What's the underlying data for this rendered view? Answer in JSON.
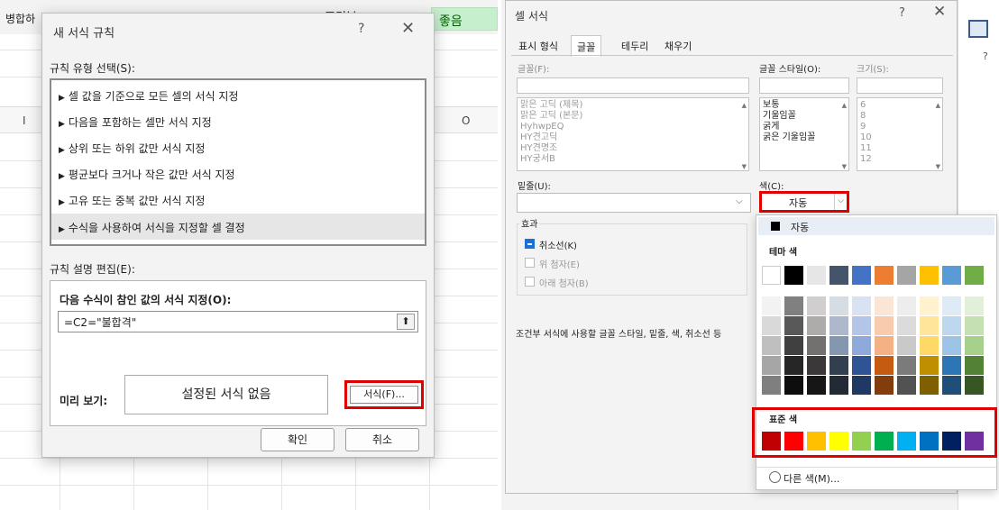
{
  "left": {
    "merge_label": "병합하",
    "cond_label": "조건부",
    "good_cell": "좋음",
    "col_i": "I",
    "col_o": "O"
  },
  "dialog1": {
    "title": "새 서식 규칙",
    "help": "?",
    "close": "✕",
    "rule_type_label": "규칙 유형 선택(S):",
    "rules": [
      "셀 값을 기준으로 모든 셀의 서식 지정",
      "다음을 포함하는 셀만 서식 지정",
      "상위 또는 하위 값만 서식 지정",
      "평균보다 크거나 작은 값만 서식 지정",
      "고유 또는 중복 값만 서식 지정",
      "수식을 사용하여 서식을 지정할 셀 결정"
    ],
    "selected_rule_index": 5,
    "rule_edit_label": "규칙 설명 편집(E):",
    "formula_label": "다음 수식이 참인 값의 서식 지정(O):",
    "formula_value": "=C2=\"불합격\"",
    "preview_label": "미리 보기:",
    "preview_text": "설정된 서식 없음",
    "format_button": "서식(F)...",
    "ok_button": "확인",
    "cancel_button": "취소"
  },
  "dialog2": {
    "title": "셀 서식",
    "help": "?",
    "close": "✕",
    "tabs": [
      "표시 형식",
      "글꼴",
      "테두리",
      "채우기"
    ],
    "active_tab": "글꼴",
    "font_label": "글꼴(F):",
    "font_list": [
      "맑은 고딕 (제목)",
      "맑은 고딕 (본문)",
      "HyhwpEQ",
      "HY견고딕",
      "HY견명조",
      "HY궁서B"
    ],
    "style_label": "글꼴 스타일(O):",
    "style_list": [
      "보통",
      "기울임꼴",
      "굵게",
      "굵은 기울임꼴"
    ],
    "size_label": "크기(S):",
    "size_list": [
      "6",
      "8",
      "9",
      "10",
      "11",
      "12"
    ],
    "underline_label": "밑줄(U):",
    "color_label": "색(C):",
    "color_value": "자동",
    "effects_label": "효과",
    "effects": [
      {
        "label": "취소선(K)",
        "checked": true
      },
      {
        "label": "위 첨자(E)",
        "checked": false
      },
      {
        "label": "아래 첨자(B)",
        "checked": false
      }
    ],
    "description": "조건부 서식에 사용할 글꼴 스타일, 밑줄, 색, 취소선 등"
  },
  "color_popup": {
    "auto_label": "자동",
    "theme_label": "테마 색",
    "theme_top": [
      "#ffffff",
      "#000000",
      "#e7e6e6",
      "#44546a",
      "#4472c4",
      "#ed7d31",
      "#a5a5a5",
      "#ffc000",
      "#5b9bd5",
      "#70ad47"
    ],
    "theme_shades": [
      [
        "#f2f2f2",
        "#808080",
        "#d0cece",
        "#d6dce4",
        "#d9e2f3",
        "#fbe5d5",
        "#ededed",
        "#fff2cc",
        "#deebf6",
        "#e2efd9"
      ],
      [
        "#d9d9d9",
        "#595959",
        "#aeabab",
        "#adb9ca",
        "#b4c6e7",
        "#f7cbac",
        "#dbdbdb",
        "#fee599",
        "#bdd7ee",
        "#c5e0b3"
      ],
      [
        "#bfbfbf",
        "#404040",
        "#757070",
        "#8496b0",
        "#8eaadb",
        "#f4b183",
        "#c9c9c9",
        "#ffd965",
        "#9dc3e6",
        "#a8d08d"
      ],
      [
        "#a6a6a6",
        "#262626",
        "#3a3838",
        "#323f4f",
        "#2f5496",
        "#c55a11",
        "#7b7b7b",
        "#bf8f00",
        "#2e75b5",
        "#538135"
      ],
      [
        "#7f7f7f",
        "#0d0d0d",
        "#171616",
        "#222a35",
        "#1f3864",
        "#833c0b",
        "#525252",
        "#7f6000",
        "#1f4e79",
        "#375623"
      ]
    ],
    "standard_label": "표준 색",
    "standard": [
      "#c00000",
      "#ff0000",
      "#ffc000",
      "#ffff00",
      "#92d050",
      "#00b050",
      "#00b0f0",
      "#0070c0",
      "#002060",
      "#7030a0"
    ],
    "more_colors": "다른 색(M)..."
  }
}
